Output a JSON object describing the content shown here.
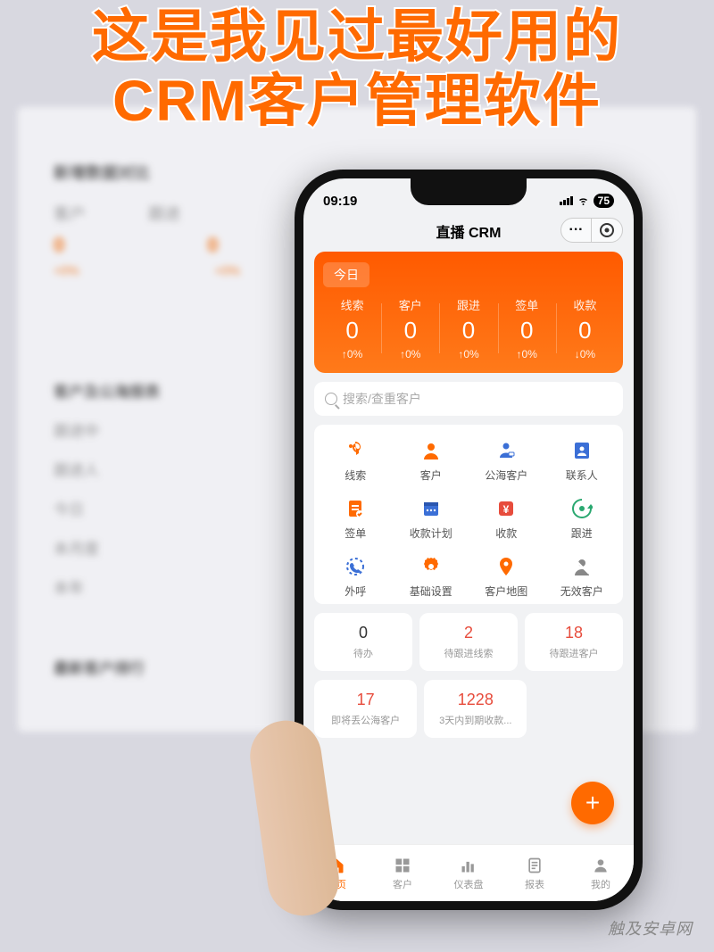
{
  "caption_line1": "这是我见过最好用的",
  "caption_line2": "CRM客户管理软件",
  "watermark": "触及安卓网",
  "bg": {
    "section1_title": "新增数据对比",
    "cols": [
      "客户",
      "跟进"
    ],
    "zero": "0",
    "pct": "+0%",
    "section2_title": "客户及公海报表",
    "rows": [
      "跟进中",
      "跟进人",
      "今日",
      "本月度",
      "本年"
    ],
    "section3_title": "最新客户排行"
  },
  "status": {
    "time": "09:19",
    "battery": "75"
  },
  "title": "直播 CRM",
  "today_label": "今日",
  "stats": [
    {
      "label": "线索",
      "value": "0",
      "pct": "↑0%"
    },
    {
      "label": "客户",
      "value": "0",
      "pct": "↑0%"
    },
    {
      "label": "跟进",
      "value": "0",
      "pct": "↑0%"
    },
    {
      "label": "签单",
      "value": "0",
      "pct": "↑0%"
    },
    {
      "label": "收款",
      "value": "0",
      "pct": "↓0%"
    }
  ],
  "search_placeholder": "搜索/查重客户",
  "grid": [
    {
      "label": "线索",
      "icon": "lead",
      "color": "#ff6a00"
    },
    {
      "label": "客户",
      "icon": "customer",
      "color": "#ff6a00"
    },
    {
      "label": "公海客户",
      "icon": "sea",
      "color": "#3b6fd6"
    },
    {
      "label": "联系人",
      "icon": "contact",
      "color": "#3b6fd6"
    },
    {
      "label": "签单",
      "icon": "order",
      "color": "#ff6a00"
    },
    {
      "label": "收款计划",
      "icon": "plan",
      "color": "#3b6fd6"
    },
    {
      "label": "收款",
      "icon": "money",
      "color": "#e74c3c"
    },
    {
      "label": "跟进",
      "icon": "follow",
      "color": "#2aa870"
    },
    {
      "label": "外呼",
      "icon": "call",
      "color": "#3b6fd6"
    },
    {
      "label": "基础设置",
      "icon": "gear",
      "color": "#ff6a00"
    },
    {
      "label": "客户地图",
      "icon": "map",
      "color": "#ff6a00"
    },
    {
      "label": "无效客户",
      "icon": "invalid",
      "color": "#888"
    }
  ],
  "cards": [
    {
      "num": "0",
      "label": "待办",
      "red": false
    },
    {
      "num": "2",
      "label": "待跟进线索",
      "red": true
    },
    {
      "num": "18",
      "label": "待跟进客户",
      "red": true
    },
    {
      "num": "17",
      "label": "即将丢公海客户",
      "red": true
    },
    {
      "num": "1228",
      "label": "3天内到期收款...",
      "red": true
    }
  ],
  "nav": [
    {
      "label": "首页",
      "icon": "home",
      "on": true
    },
    {
      "label": "客户",
      "icon": "grid",
      "on": false
    },
    {
      "label": "仪表盘",
      "icon": "dash",
      "on": false
    },
    {
      "label": "报表",
      "icon": "report",
      "on": false
    },
    {
      "label": "我的",
      "icon": "me",
      "on": false
    }
  ]
}
